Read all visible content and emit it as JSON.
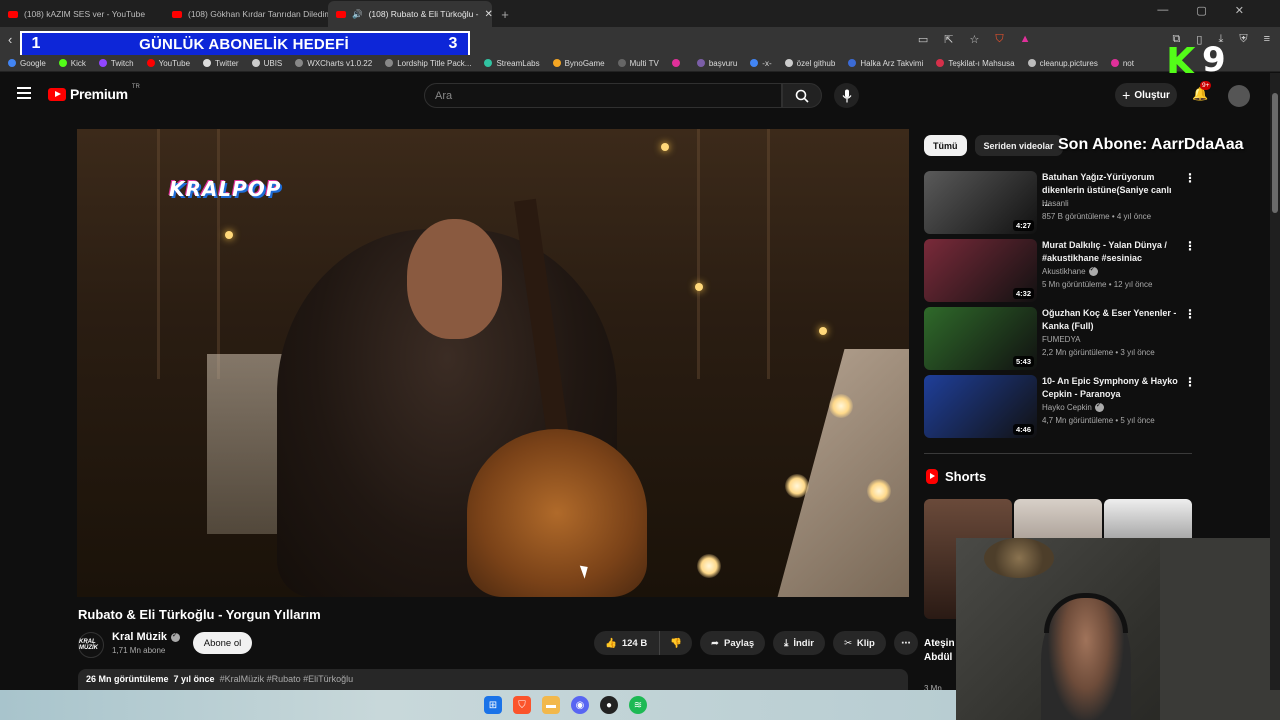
{
  "browser": {
    "tabs": [
      {
        "label": "(108) kAZIM SES ver - YouTube",
        "active": false
      },
      {
        "label": "(108) Gökhan Kırdar Tanrıdan Diledim",
        "active": false
      },
      {
        "label": "(108) Rubato & Eli Türkoğlu -",
        "active": true
      }
    ],
    "url_fragment": "watch?v=7sSWrPvuzAE",
    "bookmarks": [
      {
        "label": "Google",
        "color": "#4285f4"
      },
      {
        "label": "Kick",
        "color": "#53fc18"
      },
      {
        "label": "Twitch",
        "color": "#9146ff"
      },
      {
        "label": "YouTube",
        "color": "#ff0000"
      },
      {
        "label": "Twitter",
        "color": "#dddddd"
      },
      {
        "label": "UBIS",
        "color": "#cccccc"
      },
      {
        "label": "WXCharts v1.0.22",
        "color": "#888888"
      },
      {
        "label": "Lordship Title Pack...",
        "color": "#888888"
      },
      {
        "label": "StreamLabs",
        "color": "#31c3a2"
      },
      {
        "label": "BynoGame",
        "color": "#f5a623"
      },
      {
        "label": "Multi TV",
        "color": "#666666"
      },
      {
        "label": "",
        "color": "#e0309a"
      },
      {
        "label": "başvuru",
        "color": "#7b5ea7"
      },
      {
        "label": "-x-",
        "color": "#4285f4"
      },
      {
        "label": "özel github",
        "color": "#cccccc"
      },
      {
        "label": "Halka Arz Takvimi",
        "color": "#3b6bd6"
      },
      {
        "label": "Teşkilat-ı Mahsusa",
        "color": "#d6304a"
      },
      {
        "label": "cleanup.pictures",
        "color": "#bbbbbb"
      },
      {
        "label": "not",
        "color": "#e0309a"
      }
    ]
  },
  "goal_overlay": {
    "left": "1",
    "text": "GÜNLÜK ABONELİK HEDEFİ",
    "right": "3"
  },
  "kick_overlay": {
    "letter": "K",
    "count": "9"
  },
  "header": {
    "brand": "Premium",
    "region": "TR",
    "search_placeholder": "Ara",
    "create_label": "Oluştur",
    "notif_count": "9+"
  },
  "video": {
    "overlay_logo": "KRALPOP",
    "title": "Rubato & Eli Türkoğlu - Yorgun Yıllarım",
    "channel": "Kral Müzik",
    "channel_logo": "KRAL MÜZİK",
    "subscribers": "1,71 Mn abone",
    "subscribe_label": "Abone ol",
    "likes": "124 B",
    "share_label": "Paylaş",
    "download_label": "İndir",
    "clip_label": "Klip",
    "views": "26 Mn görüntüleme",
    "age": "7 yıl önce",
    "tags": "#KralMüzik #Rubato #EliTürkoğlu"
  },
  "sidebar": {
    "chips": [
      {
        "label": "Tümü",
        "active": true
      },
      {
        "label": "Seriden videolar",
        "active": false
      }
    ],
    "last_sub_overlay": "Son Abone: AarrDdaAaa",
    "recommendations": [
      {
        "title": "Batuhan Yağız-Yürüyorum dikenlerin üstüne(Saniye canlı ...",
        "channel": "Hasanli",
        "verified": false,
        "meta": "857 B görüntüleme • 4 yıl önce",
        "duration": "4:27",
        "thumb_color": "#5a5a5a"
      },
      {
        "title": "Murat Dalkılıç - Yalan Dünya / #akustikhane #sesiniac",
        "channel": "Akustikhane",
        "verified": true,
        "meta": "5 Mn görüntüleme • 12 yıl önce",
        "duration": "4:32",
        "thumb_color": "#7a2a3a"
      },
      {
        "title": "Oğuzhan Koç & Eser Yenenler - Kanka (Full)",
        "channel": "FUMEDYA",
        "verified": false,
        "meta": "2,2 Mn görüntüleme • 3 yıl önce",
        "duration": "5:43",
        "thumb_color": "#2f6a2a"
      },
      {
        "title": "10- An Epic Symphony & Hayko Cepkin - Paranoya",
        "channel": "Hayko Cepkin",
        "verified": true,
        "meta": "4,7 Mn görüntüleme • 5 yıl önce",
        "duration": "4:46",
        "thumb_color": "#1f3f9a"
      }
    ],
    "shorts_label": "Shorts",
    "short_caption": "Ateşin Abdül",
    "short_meta": "3 Mn görüntü"
  },
  "colors": {
    "background": "#0f0f0f",
    "brand_red": "#ff0000",
    "goal_blue": "#0d26d8",
    "kick_green": "#53fc18"
  }
}
